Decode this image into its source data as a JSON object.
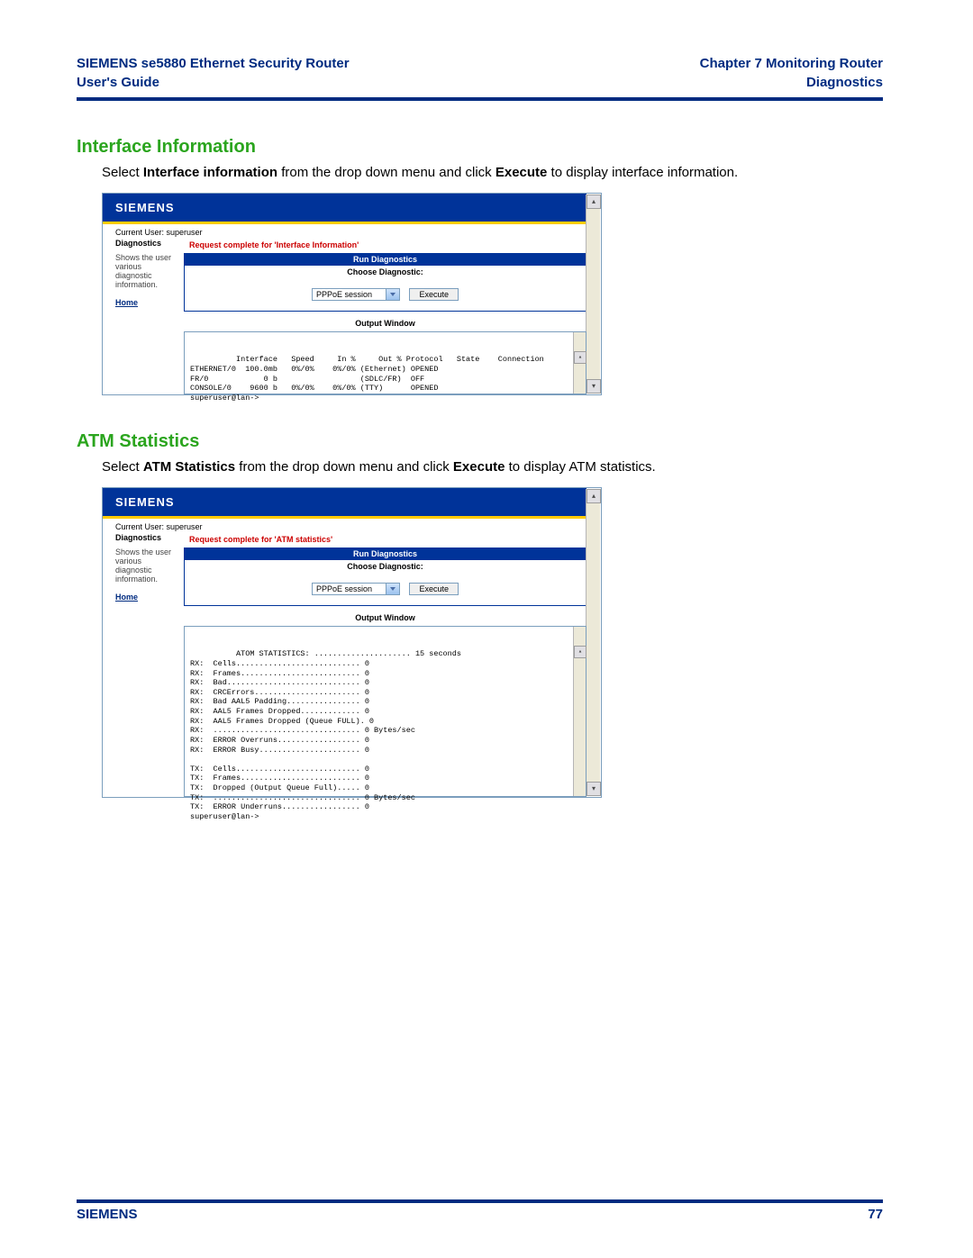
{
  "header": {
    "left_line1": "SIEMENS se5880 Ethernet Security Router",
    "left_line2": "User's Guide",
    "right_line1": "Chapter 7  Monitoring Router",
    "right_line2": "Diagnostics"
  },
  "section1": {
    "heading": "Interface Information",
    "intro_pre": "Select ",
    "intro_b1": "Interface information",
    "intro_mid": " from the drop down menu and click ",
    "intro_b2": "Execute",
    "intro_post": " to display interface information."
  },
  "ui1": {
    "logo": "SIEMENS",
    "current_user": "Current User: superuser",
    "sidebar_title": "Diagnostics",
    "sidebar_note": "Shows the user various diagnostic information.",
    "sidebar_home": "Home",
    "status": "Request complete for 'Interface Information'",
    "run_label": "Run Diagnostics",
    "choose_label": "Choose Diagnostic:",
    "dropdown_value": "PPPoE session",
    "execute_label": "Execute",
    "output_label": "Output Window",
    "output_text": "Interface   Speed     In %     Out % Protocol   State    Connection\nETHERNET/0  100.0mb   0%/0%    0%/0% (Ethernet) OPENED\nFR/0            0 b                  (SDLC/FR)  OFF\nCONSOLE/0    9600 b   0%/0%    0%/0% (TTY)      OPENED\nsuperuser@lan->"
  },
  "section2": {
    "heading": "ATM Statistics",
    "intro_pre": "Select ",
    "intro_b1": "ATM Statistics",
    "intro_mid": " from the drop down menu and click ",
    "intro_b2": "Execute",
    "intro_post": " to display ATM statistics."
  },
  "ui2": {
    "logo": "SIEMENS",
    "current_user": "Current User: superuser",
    "sidebar_title": "Diagnostics",
    "sidebar_note": "Shows the user various diagnostic information.",
    "sidebar_home": "Home",
    "status": "Request complete for 'ATM statistics'",
    "run_label": "Run Diagnostics",
    "choose_label": "Choose Diagnostic:",
    "dropdown_value": "PPPoE session",
    "execute_label": "Execute",
    "output_label": "Output Window",
    "output_text": "ATOM STATISTICS: ..................... 15 seconds\nRX:  Cells........................... 0\nRX:  Frames.......................... 0\nRX:  Bad............................. 0\nRX:  CRCErrors....................... 0\nRX:  Bad AAL5 Padding................ 0\nRX:  AAL5 Frames Dropped............. 0\nRX:  AAL5 Frames Dropped (Queue FULL). 0\nRX:  ................................ 0 Bytes/sec\nRX:  ERROR Overruns.................. 0\nRX:  ERROR Busy...................... 0\n\nTX:  Cells........................... 0\nTX:  Frames.......................... 0\nTX:  Dropped (Output Queue Full)..... 0\nTX:  ................................ 0 Bytes/sec\nTX:  ERROR Underruns................. 0\nsuperuser@lan->"
  },
  "footer": {
    "brand": "SIEMENS",
    "page": "77"
  },
  "glyphs": {
    "up": "▴",
    "down": "▾"
  }
}
